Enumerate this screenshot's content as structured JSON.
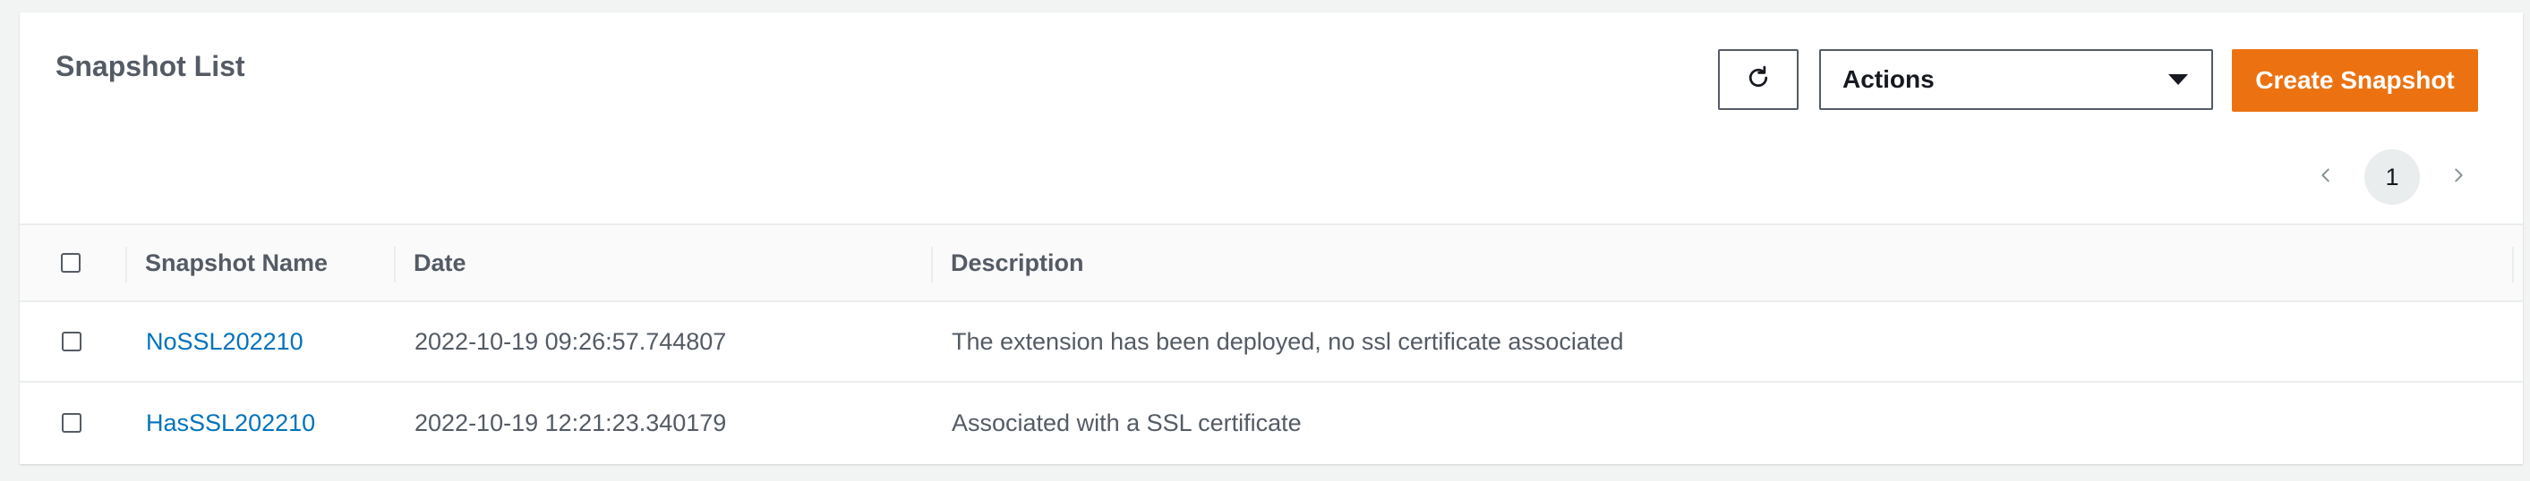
{
  "header": {
    "title": "Snapshot List",
    "refresh_icon": "refresh-icon",
    "actions_label": "Actions",
    "create_label": "Create Snapshot"
  },
  "pagination": {
    "current_page": "1",
    "prev_icon": "chevron-left-icon",
    "next_icon": "chevron-right-icon"
  },
  "table": {
    "columns": [
      "Snapshot Name",
      "Date",
      "Description"
    ],
    "rows": [
      {
        "name": "NoSSL202210",
        "date": "2022-10-19 09:26:57.744807",
        "description": "The extension has been deployed, no ssl certificate associated"
      },
      {
        "name": "HasSSL202210",
        "date": "2022-10-19 12:21:23.340179",
        "description": "Associated with a SSL certificate"
      }
    ]
  },
  "colors": {
    "accent": "#ec7211",
    "link": "#0073bb",
    "text_secondary": "#545b64"
  }
}
